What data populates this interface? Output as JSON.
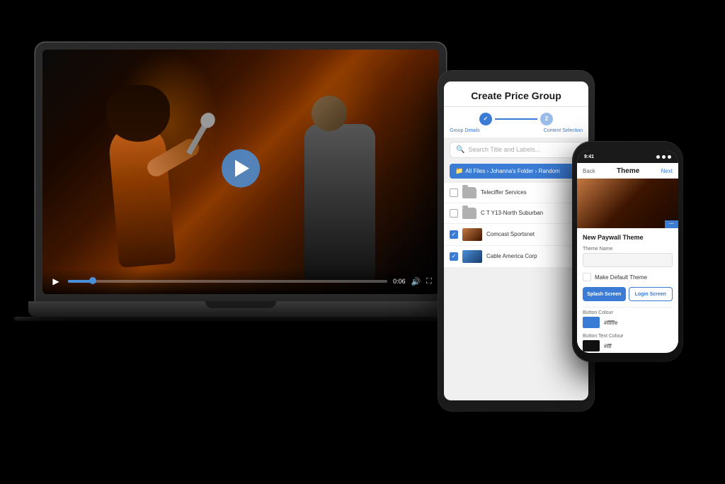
{
  "background": "#000000",
  "laptop": {
    "video": {
      "play_button_label": "▶",
      "time": "0:06",
      "time_label": "0:06"
    },
    "controls": {
      "play": "▶",
      "volume": "🔊",
      "fullscreen": "⛶"
    }
  },
  "tablet": {
    "title": "Create Price Group",
    "steps": [
      {
        "label": "1",
        "state": "active"
      },
      {
        "label": "2",
        "state": "inactive"
      }
    ],
    "step_labels": {
      "left": "Group Details",
      "right": "Content Selection"
    },
    "search_placeholder": "Search Title and Labels...",
    "breadcrumb": "All Files › Johanna's Folder › Random",
    "files": [
      {
        "name": "Teleciffer Services",
        "type": "folder",
        "checked": false
      },
      {
        "name": "C T Y13-North Suburban",
        "type": "folder",
        "checked": false
      },
      {
        "name": "Comcast Sportsnet",
        "type": "video",
        "checked": true
      },
      {
        "name": "Cable America Corp",
        "type": "video",
        "checked": true
      }
    ]
  },
  "phone": {
    "status_bar": {
      "time": "9:41",
      "back_label": "Back",
      "title": "Theme",
      "next_label": "Next"
    },
    "concert_thumb_button": "···",
    "section_title": "New Paywall Theme",
    "fields": [
      {
        "label": "Theme Name",
        "value": ""
      },
      {
        "label": "Make Default Theme",
        "type": "checkbox"
      },
      {
        "label": "Button Colour",
        "value": "#fffffe"
      },
      {
        "label": "Button Text Colour",
        "value": "#fff"
      }
    ],
    "buttons": [
      {
        "label": "Splash Screen"
      },
      {
        "label": "Login Screen"
      }
    ],
    "button_colour_label": "Button Colour",
    "button_colour_value": "#fffffe",
    "button_text_colour_label": "Button Text Colour",
    "button_text_colour_value": "#fff"
  }
}
